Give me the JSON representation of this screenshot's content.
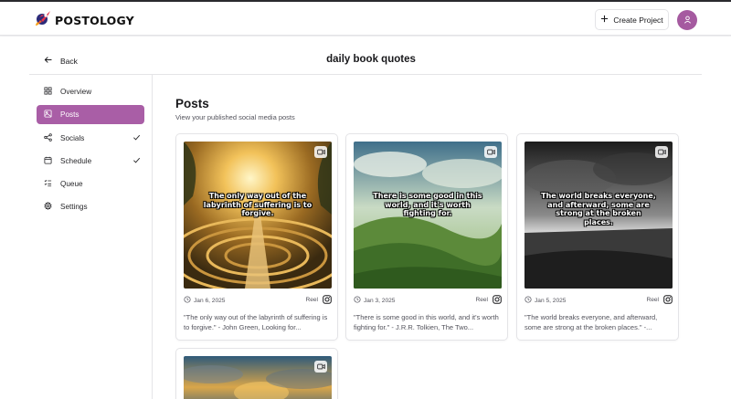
{
  "app": {
    "name": "POSTOLOGY"
  },
  "header": {
    "create_label": "Create Project",
    "avatar_icon": "user-icon"
  },
  "project": {
    "back_label": "Back",
    "title": "daily book quotes"
  },
  "sidebar": {
    "items": [
      {
        "label": "Overview",
        "icon": "grid-icon",
        "active": false,
        "checked": false
      },
      {
        "label": "Posts",
        "icon": "image-icon",
        "active": true,
        "checked": false
      },
      {
        "label": "Socials",
        "icon": "share-icon",
        "active": false,
        "checked": true
      },
      {
        "label": "Schedule",
        "icon": "calendar-icon",
        "active": false,
        "checked": true
      },
      {
        "label": "Queue",
        "icon": "list-icon",
        "active": false,
        "checked": false
      },
      {
        "label": "Settings",
        "icon": "gear-icon",
        "active": false,
        "checked": false
      }
    ]
  },
  "main": {
    "title": "Posts",
    "subtitle": "View your published social media posts",
    "posts": [
      {
        "overlay": "The only way out of the labyrinth of suffering is to forgive.",
        "date": "Jan 6, 2025",
        "type": "Reel",
        "caption": "\"The only way out of the labyrinth of suffering is to forgive.\" - John Green, Looking for..."
      },
      {
        "overlay": "There is some good in this world, and it's worth fighting for.",
        "date": "Jan 3, 2025",
        "type": "Reel",
        "caption": "\"There is some good in this world, and it's worth fighting for.\" - J.R.R. Tolkien, The Two..."
      },
      {
        "overlay": "The world breaks everyone, and afterward, some are strong at the broken places.",
        "date": "Jan 5, 2025",
        "type": "Reel",
        "caption": "\"The world breaks everyone, and afterward, some are strong at the broken places.\" -..."
      },
      {
        "overlay": "",
        "date": "",
        "type": "",
        "caption": ""
      }
    ]
  },
  "colors": {
    "accent": "#a95ea6",
    "avatar": "#a55aa0",
    "border": "#e4e4e7",
    "muted_text": "#52525b"
  }
}
